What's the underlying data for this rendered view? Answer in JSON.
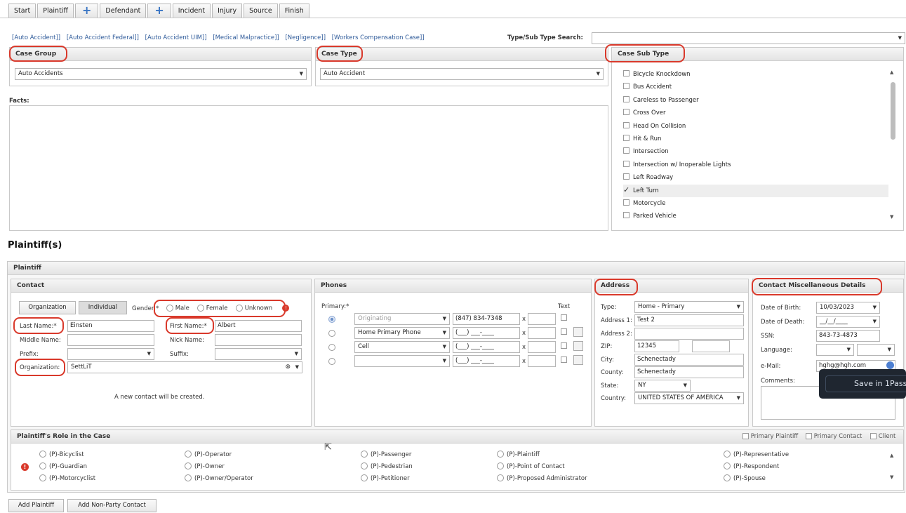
{
  "tabs": [
    "Start",
    "Plaintiff",
    "+",
    "Defendant",
    "+",
    "Incident",
    "Injury",
    "Source",
    "Finish"
  ],
  "quick_links": [
    "[Auto Accident]]",
    "[Auto Accident Federal]]",
    "[Auto Accident UIM]]",
    "[Medical Malpractice]]",
    "[Negligence]]",
    "[Workers Compensation Case]]"
  ],
  "type_search": {
    "label": "Type/Sub Type Search:",
    "value": ""
  },
  "case_group": {
    "title": "Case Group",
    "value": "Auto Accidents"
  },
  "case_type": {
    "title": "Case Type",
    "value": "Auto Accident"
  },
  "case_sub_type": {
    "title": "Case Sub Type",
    "items": [
      {
        "label": "Bicycle Knockdown",
        "checked": false
      },
      {
        "label": "Bus Accident",
        "checked": false
      },
      {
        "label": "Careless to Passenger",
        "checked": false
      },
      {
        "label": "Cross Over",
        "checked": false
      },
      {
        "label": "Head On Collision",
        "checked": false
      },
      {
        "label": "Hit & Run",
        "checked": false
      },
      {
        "label": "Intersection",
        "checked": false
      },
      {
        "label": "Intersection w/ Inoperable Lights",
        "checked": false
      },
      {
        "label": "Left Roadway",
        "checked": false
      },
      {
        "label": "Left Turn",
        "checked": true
      },
      {
        "label": "Motorcycle",
        "checked": false
      },
      {
        "label": "Parked Vehicle",
        "checked": false
      }
    ]
  },
  "facts": {
    "label": "Facts:",
    "value": ""
  },
  "plaintiffs_heading": "Plaintiff(s)",
  "plaintiff_panel_title": "Plaintiff",
  "contact": {
    "title": "Contact",
    "btn_org": "Organization",
    "btn_ind": "Individual",
    "gender_label": "Gender:*",
    "gender_options": [
      "Male",
      "Female",
      "Unknown"
    ],
    "last_name_label": "Last Name:*",
    "last_name": "Einsten",
    "first_name_label": "First Name:*",
    "first_name": "Albert",
    "middle_name_label": "Middle Name:",
    "middle_name": "",
    "nick_name_label": "Nick Name:",
    "nick_name": "",
    "prefix_label": "Prefix:",
    "prefix": "",
    "suffix_label": "Suffix:",
    "suffix": "",
    "organization_label": "Organization:",
    "organization": "SettLiT",
    "note": "A new contact will be created."
  },
  "phones": {
    "title": "Phones",
    "primary_label": "Primary:*",
    "text_label": "Text",
    "rows": [
      {
        "type": "Originating",
        "number": "(847) 834-7348",
        "ext_label": "x",
        "primary": true
      },
      {
        "type": "Home Primary Phone",
        "number": "(___) ___-____",
        "ext_label": "x",
        "primary": false
      },
      {
        "type": "Cell",
        "number": "(___) ___-____",
        "ext_label": "x",
        "primary": false
      },
      {
        "type": "",
        "number": "(___) ___-____",
        "ext_label": "x",
        "primary": false
      }
    ]
  },
  "address": {
    "title": "Address",
    "type_label": "Type:",
    "type": "Home - Primary",
    "addr1_label": "Address 1:",
    "addr1": "Test 2",
    "addr2_label": "Address 2:",
    "addr2": "",
    "zip_label": "ZIP:",
    "zip": "12345",
    "city_label": "City:",
    "city": "Schenectady",
    "county_label": "County:",
    "county": "Schenectady",
    "state_label": "State:",
    "state": "NY",
    "country_label": "Country:",
    "country": "UNITED STATES OF AMERICA"
  },
  "misc": {
    "title": "Contact Miscellaneous Details",
    "dob_label": "Date of Birth:",
    "dob": "10/03/2023",
    "dod_label": "Date of Death:",
    "dod": "__/__/____",
    "ssn_label": "SSN:",
    "ssn": "843-73-4873",
    "language_label": "Language:",
    "email_label": "e-Mail:",
    "email": "hghg@hgh.com",
    "comments_label": "Comments:",
    "save_popup": "Save in 1Pass"
  },
  "role": {
    "title": "Plaintiff's Role in the Case",
    "flags": [
      "Primary Plaintiff",
      "Primary Contact",
      "Client"
    ],
    "columns": [
      [
        "(P)-Bicyclist",
        "(P)-Guardian",
        "(P)-Motorcyclist"
      ],
      [
        "(P)-Operator",
        "(P)-Owner",
        "(P)-Owner/Operator"
      ],
      [
        "(P)-Passenger",
        "(P)-Pedestrian",
        "(P)-Petitioner"
      ],
      [
        "(P)-Plaintiff",
        "(P)-Point of Contact",
        "(P)-Proposed Administrator"
      ],
      [
        "(P)-Representative",
        "(P)-Respondent",
        "(P)-Spouse"
      ]
    ]
  },
  "bottom_buttons": [
    "Add Plaintiff",
    "Add Non-Party Contact"
  ]
}
